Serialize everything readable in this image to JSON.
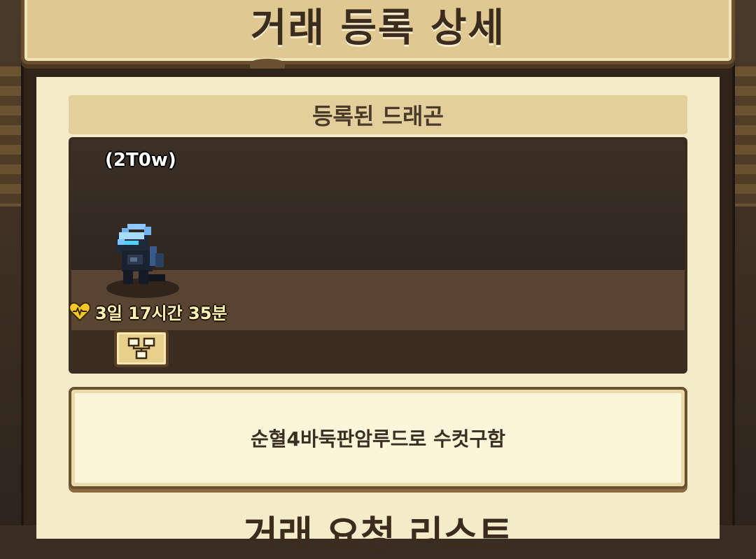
{
  "header": {
    "title": "거래 등록 상세"
  },
  "registered_dragon": {
    "section_label": "등록된 드래곤",
    "name": "(2T0w)",
    "timer": "3일 17시간 35분",
    "sprite_icon": "dragon-sprite",
    "tree_icon": "family-tree-icon"
  },
  "description": {
    "text": "순혈4바둑판암루드로 수컷구함"
  },
  "next_section": {
    "title": "거래 요청 리스트"
  },
  "colors": {
    "panel_bg": "#f4ebc8",
    "title_bar": "#e0c892",
    "dark_panel": "#2a2018",
    "timer_text": "#fff2b0"
  }
}
